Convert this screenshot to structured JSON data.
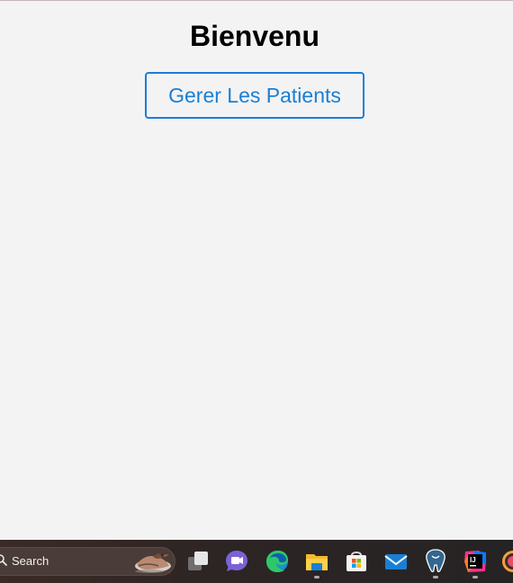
{
  "page": {
    "title": "Bienvenu",
    "manage_patients_button": "Gerer Les Patients"
  },
  "taskbar": {
    "search_label": "Search",
    "pinned_apps": [
      {
        "icon": "task-view-icon"
      },
      {
        "icon": "teams-chat-icon"
      },
      {
        "icon": "edge-browser-icon"
      },
      {
        "icon": "file-explorer-icon"
      },
      {
        "icon": "microsoft-store-icon"
      },
      {
        "icon": "mail-icon"
      },
      {
        "icon": "pgadmin-icon"
      },
      {
        "icon": "intellij-idea-icon"
      },
      {
        "icon": "app-icon-partial"
      }
    ]
  },
  "colors": {
    "background": "#f3f3f4",
    "accent": "#1a7fd4",
    "taskbar": "#2d2524"
  }
}
